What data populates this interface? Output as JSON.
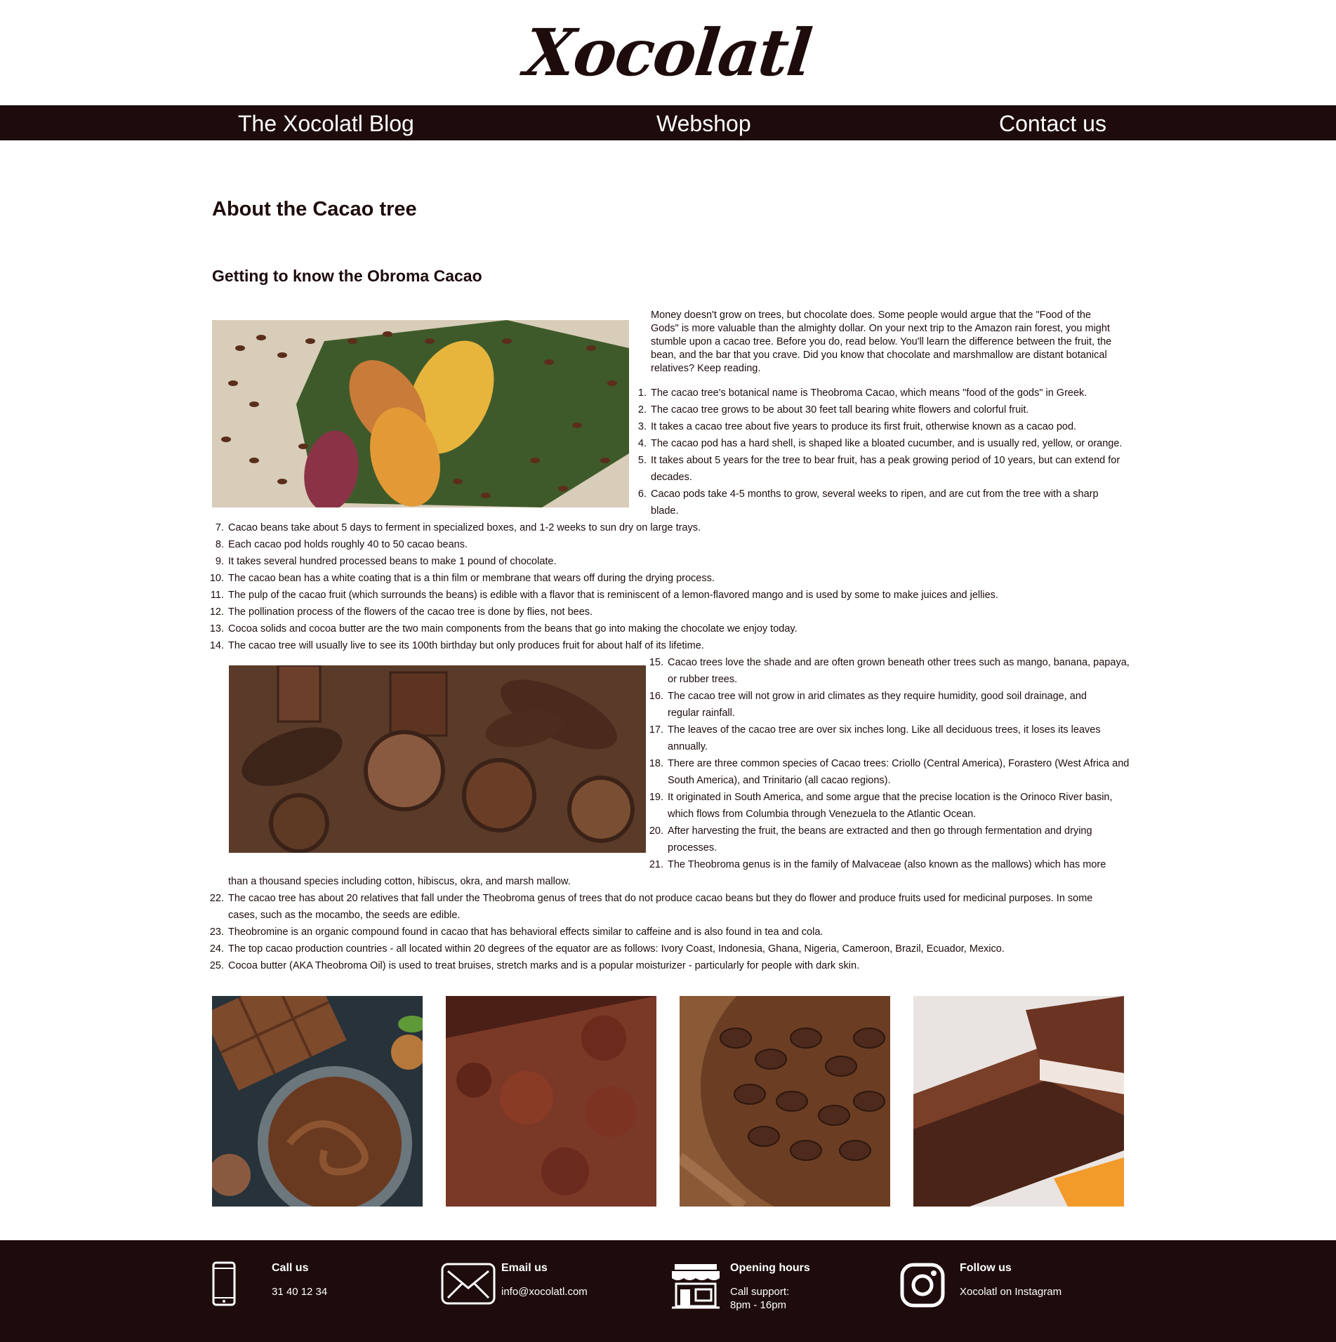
{
  "logo": {
    "text": "Xocolatl"
  },
  "nav": {
    "blog": "The Xocolatl Blog",
    "webshop": "Webshop",
    "contact": "Contact us"
  },
  "page": {
    "title": "About the Cacao tree",
    "subtitle": "Getting to know the Obroma Cacao",
    "intro": "Money doesn't grow on trees, but chocolate does. Some people would argue that the \"Food of the Gods\" is more valuable than the almighty dollar. On your next trip to the Amazon rain forest, you might stumble upon a cacao tree. Before you do, read below. You'll learn the difference between the fruit, the bean, and the bar that you crave. Did you know that chocolate and marshmallow are distant botanical relatives? Keep reading."
  },
  "facts": [
    {
      "n": "1.",
      "t": "The cacao tree's botanical name is Theobroma Cacao, which means \"food of the gods\" in Greek."
    },
    {
      "n": "2.",
      "t": "The cacao tree grows to be about 30 feet tall bearing white flowers and colorful fruit."
    },
    {
      "n": "3.",
      "t": "It takes a cacao tree about five years to produce its first fruit, otherwise known as a cacao pod."
    },
    {
      "n": "4.",
      "t": "The cacao pod has a hard shell, is shaped like a bloated cucumber, and is usually red, yellow, or orange."
    },
    {
      "n": "5.",
      "t": "It takes about 5 years for the tree to bear fruit, has a peak growing period of 10 years, but can extend for decades."
    },
    {
      "n": "6.",
      "t": "Cacao pods take 4-5 months to grow, several weeks to ripen, and are cut from the tree with a sharp blade."
    },
    {
      "n": "7.",
      "t": "Cacao beans take about 5 days to ferment in specialized boxes, and 1-2 weeks to sun dry on large trays."
    },
    {
      "n": "8.",
      "t": "Each cacao pod holds roughly 40 to 50 cacao beans."
    },
    {
      "n": "9.",
      "t": "It takes several hundred processed beans to make 1 pound of chocolate."
    },
    {
      "n": "10.",
      "t": "The cacao bean has a white coating that is a thin film or membrane that wears off during the drying process."
    },
    {
      "n": "11.",
      "t": "The pulp of the cacao fruit (which surrounds the beans) is edible with a flavor that is reminiscent of a lemon-flavored mango and is used by some to make juices and jellies."
    },
    {
      "n": "12.",
      "t": "The pollination process of the flowers of the cacao tree is done by flies, not bees."
    },
    {
      "n": "13.",
      "t": "Cocoa solids and cocoa butter are the two main components from the beans that go into making the chocolate we enjoy today."
    },
    {
      "n": "14.",
      "t": "The cacao tree will usually live to see its 100th birthday but only produces fruit for about half of its lifetime."
    },
    {
      "n": "15.",
      "t": "Cacao trees love the shade and are often grown beneath other trees such as mango, banana, papaya, or rubber trees."
    },
    {
      "n": "16.",
      "t": "The cacao tree will not grow in arid climates as they require humidity, good soil drainage, and regular rainfall."
    },
    {
      "n": "17.",
      "t": "The leaves of the cacao tree are over six inches long. Like all deciduous trees, it loses its leaves annually."
    },
    {
      "n": "18.",
      "t": "There are three common species of Cacao trees: Criollo (Central America), Forastero (West Africa and South America), and Trinitario (all cacao regions)."
    },
    {
      "n": "19.",
      "t": "It originated in South America, and some argue that the precise location is the Orinoco River basin, which flows from Columbia through Venezuela to the Atlantic Ocean."
    },
    {
      "n": "20.",
      "t": "After harvesting the fruit, the beans are extracted and then go through fermentation and drying processes."
    },
    {
      "n": "21.",
      "t": "The Theobroma genus is in the family of Malvaceae (also known as the mallows) which has more"
    },
    {
      "n": "",
      "t": "than a thousand species including cotton, hibiscus, okra, and marsh mallow."
    },
    {
      "n": "22.",
      "t": "The cacao tree has about 20 relatives that fall under the Theobroma genus of trees that do not produce cacao beans but they do flower and produce fruits used for medicinal purposes. In some cases, such as the mocambo, the seeds are edible."
    },
    {
      "n": "23.",
      "t": "Theobromine is an organic compound found in cacao that has behavioral effects similar to caffeine and is also found in tea and cola."
    },
    {
      "n": "24.",
      "t": "The top cacao production countries - all located within 20 degrees of the equator are as follows: Ivory Coast, Indonesia, Ghana, Nigeria, Cameroon, Brazil, Ecuador, Mexico."
    },
    {
      "n": "25.",
      "t": "Cocoa butter (AKA Theobroma Oil) is used to treat bruises, stretch marks and is a popular moisturizer - particularly for people with dark skin."
    }
  ],
  "footer": {
    "call": {
      "title": "Call us",
      "text": "31 40 12 34"
    },
    "email": {
      "title": "Email us",
      "text": "info@xocolatl.com"
    },
    "hours": {
      "title": "Opening hours",
      "line1": "Call support:",
      "line2": "8pm - 16pm"
    },
    "follow": {
      "title": "Follow us",
      "text": "Xocolatl on Instagram"
    }
  },
  "colors": {
    "brand_dark": "#1e0c0c",
    "text": "#1e0c0c",
    "background": "#ffffff"
  },
  "icons": [
    "phone-icon",
    "envelope-icon",
    "storefront-icon",
    "instagram-icon"
  ]
}
